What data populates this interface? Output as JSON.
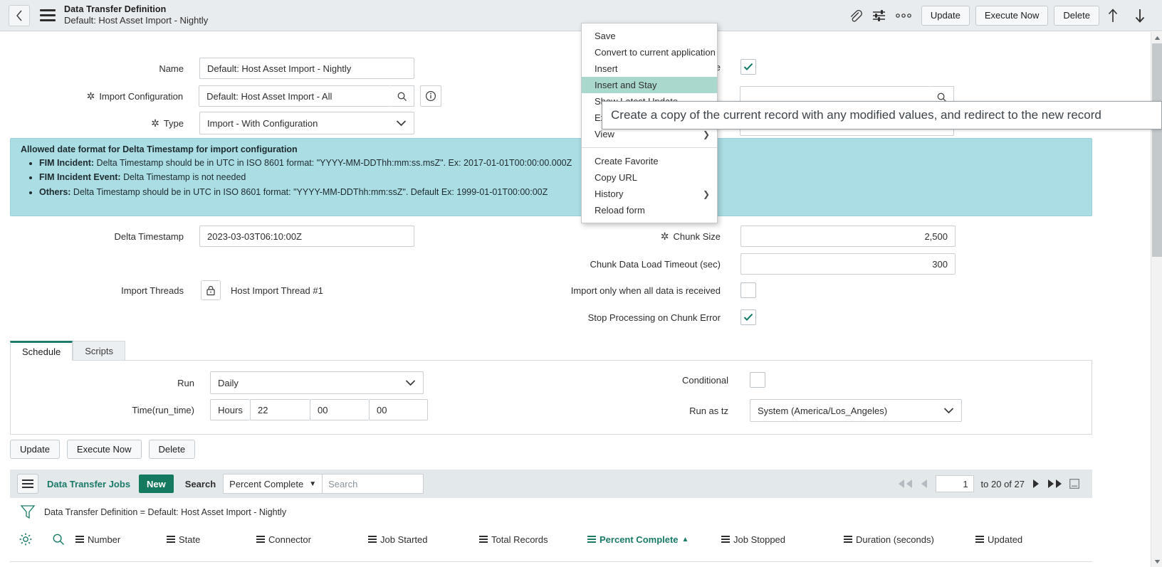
{
  "header": {
    "back_icon": "chevron-left-icon",
    "menu_icon": "hamburger-icon",
    "title": "Data Transfer Definition",
    "subtitle": "Default: Host Asset Import - Nightly",
    "attachment_icon": "paperclip-icon",
    "personalize_icon": "sliders-icon",
    "more_icon": "more-horizontal-icon",
    "update_label": "Update",
    "execute_now_label": "Execute Now",
    "delete_label": "Delete",
    "prev_record_icon": "arrow-up-icon",
    "next_record_icon": "arrow-down-icon"
  },
  "context_menu": {
    "items": [
      {
        "label": "Save",
        "highlighted": false,
        "submenu": false
      },
      {
        "label": "Convert to current application",
        "highlighted": false,
        "submenu": false
      },
      {
        "label": "Insert",
        "highlighted": false,
        "submenu": false
      },
      {
        "label": "Insert and Stay",
        "highlighted": true,
        "submenu": false
      },
      {
        "label": "Show Latest Update",
        "highlighted": false,
        "submenu": false
      },
      {
        "label": "Export",
        "highlighted": false,
        "submenu": true
      },
      {
        "label": "View",
        "highlighted": false,
        "submenu": true
      }
    ],
    "items2": [
      {
        "label": "Create Favorite",
        "highlighted": false,
        "submenu": false
      },
      {
        "label": "Copy URL",
        "highlighted": false,
        "submenu": false
      },
      {
        "label": "History",
        "highlighted": false,
        "submenu": true
      },
      {
        "label": "Reload form",
        "highlighted": false,
        "submenu": false
      }
    ]
  },
  "tooltip": {
    "text": "Create a copy of the current record with any modified values, and redirect to the new record"
  },
  "form": {
    "name_label": "Name",
    "name_value": "Default: Host Asset Import - Nightly",
    "import_config_label": "Import Configuration",
    "import_config_value": "Default: Host Asset Import - All",
    "import_config_search_icon": "search-icon",
    "import_config_info_icon": "info-icon",
    "type_label": "Type",
    "type_value": "Import - With Configuration",
    "active_label": "Active",
    "active_checked": true,
    "right_ref_search_icon": "search-icon",
    "delta_timestamp_label": "Delta Timestamp",
    "delta_timestamp_value": "2023-03-03T06:10:00Z",
    "import_threads_label": "Import Threads",
    "import_threads_lock_icon": "lock-icon",
    "import_threads_value": "Host Import Thread #1",
    "chunk_size_label": "Chunk Size",
    "chunk_size_value": "2,500",
    "chunk_timeout_label": "Chunk Data Load Timeout (sec)",
    "chunk_timeout_value": "300",
    "import_only_label": "Import only when all data is received",
    "import_only_checked": false,
    "stop_processing_label": "Stop Processing on Chunk Error",
    "stop_processing_checked": true
  },
  "banner": {
    "heading": "Allowed date format for Delta Timestamp for import configuration",
    "bullets": [
      {
        "bold": "FIM Incident:",
        "rest": " Delta Timestamp should be in UTC in ISO 8601 format: \"YYYY-MM-DDThh:mm:ss.msZ\". Ex: 2017-01-01T00:00:00.000Z"
      },
      {
        "bold": "FIM Incident Event:",
        "rest": " Delta Timestamp is not needed"
      },
      {
        "bold": "Others:",
        "rest": " Delta Timestamp should be in UTC in ISO 8601 format: \"YYYY-MM-DDThh:mm:ssZ\". Default Ex: 1999-01-01T00:00:00Z"
      }
    ]
  },
  "tabs": {
    "schedule_label": "Schedule",
    "scripts_label": "Scripts"
  },
  "schedule": {
    "run_label": "Run",
    "run_value": "Daily",
    "time_label": "Time(run_time)",
    "time_unit": "Hours",
    "time_hours": "22",
    "time_minutes": "00",
    "time_seconds": "00",
    "conditional_label": "Conditional",
    "conditional_checked": false,
    "run_as_tz_label": "Run as tz",
    "run_as_tz_value": "System (America/Los_Angeles)"
  },
  "form_buttons": {
    "update_label": "Update",
    "execute_now_label": "Execute Now",
    "delete_label": "Delete"
  },
  "related_list": {
    "menu_icon": "list-menu-icon",
    "title": "Data Transfer Jobs",
    "new_label": "New",
    "search_label": "Search",
    "search_field": "Percent Complete",
    "search_placeholder": "Search",
    "first_icon": "double-left-arrow-icon",
    "prev_icon": "left-arrow-icon",
    "page_value": "1",
    "range_text": "to 20 of 27",
    "next_icon": "right-arrow-icon",
    "last_icon": "double-right-arrow-icon",
    "collapse_icon": "collapse-icon",
    "filter_icon": "funnel-icon",
    "filter_text": "Data Transfer Definition = Default: Host Asset Import - Nightly",
    "gear_icon": "gear-icon",
    "search_row_icon": "search-icon",
    "columns": [
      {
        "label": "Number",
        "sorted": false,
        "sort_dir": ""
      },
      {
        "label": "State",
        "sorted": false,
        "sort_dir": ""
      },
      {
        "label": "Connector",
        "sorted": false,
        "sort_dir": ""
      },
      {
        "label": "Job Started",
        "sorted": false,
        "sort_dir": ""
      },
      {
        "label": "Total Records",
        "sorted": false,
        "sort_dir": ""
      },
      {
        "label": "Percent Complete",
        "sorted": true,
        "sort_dir": "▲"
      },
      {
        "label": "Job Stopped",
        "sorted": false,
        "sort_dir": ""
      },
      {
        "label": "Duration (seconds)",
        "sorted": false,
        "sort_dir": ""
      },
      {
        "label": "Updated",
        "sorted": false,
        "sort_dir": ""
      }
    ]
  },
  "colors": {
    "accent_green": "#15795f",
    "link_green": "#1a7a68",
    "banner_blue": "#abdde5",
    "menu_highlight": "#a9d8cd",
    "header_bg": "#e8ecee"
  }
}
